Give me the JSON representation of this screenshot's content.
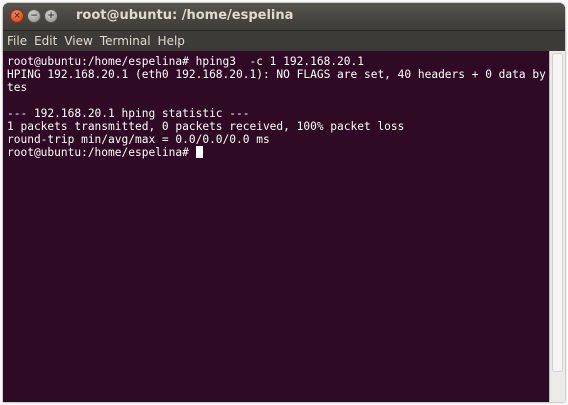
{
  "window": {
    "title": "root@ubuntu: /home/espelina",
    "controls": {
      "close_icon": "×",
      "minimize_icon": "−",
      "maximize_icon": "+"
    }
  },
  "menubar": {
    "items": [
      "File",
      "Edit",
      "View",
      "Terminal",
      "Help"
    ]
  },
  "terminal": {
    "lines": [
      "root@ubuntu:/home/espelina# hping3  -c 1 192.168.20.1",
      "HPING 192.168.20.1 (eth0 192.168.20.1): NO FLAGS are set, 40 headers + 0 data by",
      "tes",
      "",
      "--- 192.168.20.1 hping statistic ---",
      "1 packets transmitted, 0 packets received, 100% packet loss",
      "round-trip min/avg/max = 0.0/0.0/0.0 ms"
    ],
    "prompt": "root@ubuntu:/home/espelina# "
  },
  "colors": {
    "terminal_background": "#2e0a24",
    "terminal_foreground": "#ffffff",
    "close_button": "#e2561f",
    "titlebar": "#3d3c37"
  }
}
